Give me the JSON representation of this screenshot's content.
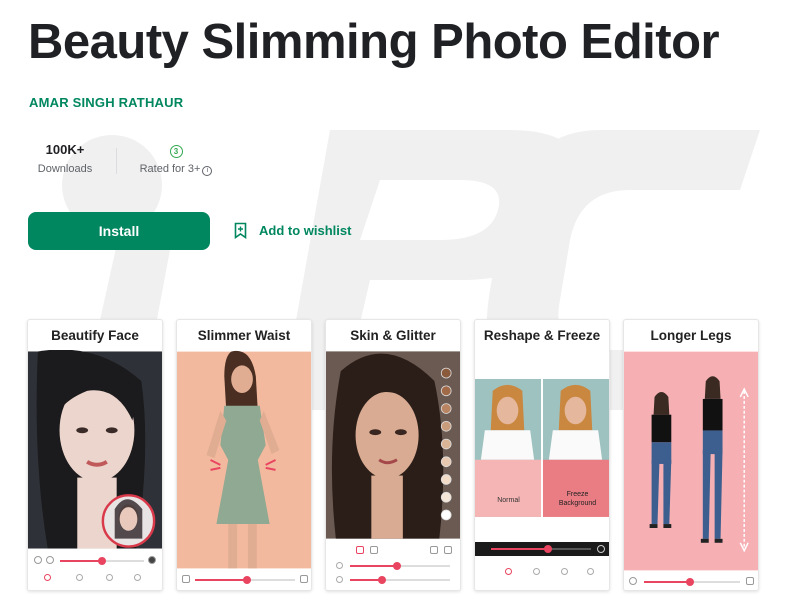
{
  "app": {
    "title": "Beauty Slimming Photo Editor",
    "developer": "AMAR SINGH RATHAUR"
  },
  "stats": {
    "downloads_value": "100K+",
    "downloads_label": "Downloads",
    "rating_badge": "3",
    "rating_label": "Rated for 3+"
  },
  "actions": {
    "install_label": "Install",
    "wishlist_label": "Add to wishlist"
  },
  "screenshots": [
    {
      "title": "Beautify Face"
    },
    {
      "title": "Slimmer Waist"
    },
    {
      "title": "Skin & Glitter"
    },
    {
      "title": "Reshape & Freeze",
      "tags": {
        "left": "Normal",
        "right_line1": "Freeze",
        "right_line2": "Background"
      }
    },
    {
      "title": "Longer Legs"
    }
  ],
  "icons": [
    "info-icon",
    "bookmark-add-icon",
    "rating-badge-icon"
  ],
  "colors": {
    "accent": "#01875f",
    "text": "#202124",
    "muted": "#5f6368",
    "slider": "#e94560",
    "watermark": "#ececec"
  }
}
